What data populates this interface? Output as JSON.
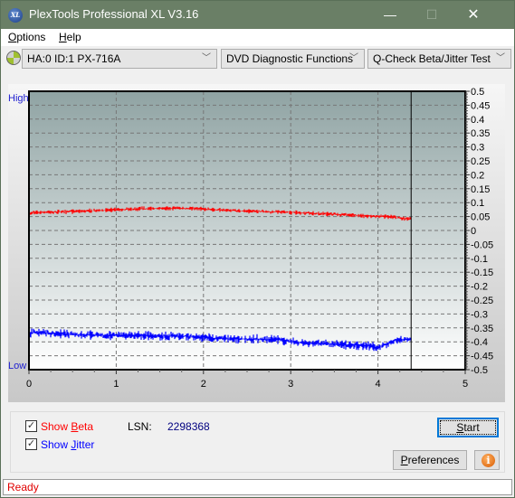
{
  "window": {
    "title": "PlexTools Professional XL V3.16",
    "app_icon_text": "XL",
    "controls": {
      "minimize": "—",
      "maximize": "☐",
      "close": "✕"
    }
  },
  "menu": {
    "items": [
      {
        "label": "Options",
        "accel": "O",
        "rest": "ptions"
      },
      {
        "label": "Help",
        "accel": "H",
        "rest": "elp"
      }
    ]
  },
  "toolbar": {
    "drive_select": "HA:0 ID:1  PX-716A",
    "function_select": "DVD Diagnostic Functions",
    "test_select": "Q-Check Beta/Jitter Test",
    "chevron": "﹀"
  },
  "chart_data": {
    "type": "line",
    "title": "",
    "xlabel": "",
    "ylabel": "",
    "y_left_labels": {
      "top": "High",
      "bottom": "Low"
    },
    "xlim": [
      0,
      5
    ],
    "ylim": [
      -0.5,
      0.5
    ],
    "x_ticks": [
      "0",
      "1",
      "2",
      "3",
      "4",
      "5"
    ],
    "y_ticks": [
      "0.5",
      "0.45",
      "0.4",
      "0.35",
      "0.3",
      "0.25",
      "0.2",
      "0.15",
      "0.1",
      "0.05",
      "0",
      "-0.05",
      "-0.1",
      "-0.15",
      "-0.2",
      "-0.25",
      "-0.3",
      "-0.35",
      "-0.4",
      "-0.45",
      "-0.5"
    ],
    "grid": true,
    "marker_x": 4.38,
    "series": [
      {
        "name": "Beta",
        "color": "#ff0000",
        "x": [
          0,
          0.05,
          0.2,
          0.5,
          0.8,
          1.0,
          1.2,
          1.5,
          1.7,
          2.0,
          2.2,
          2.5,
          3.0,
          3.5,
          3.9,
          4.1,
          4.3,
          4.38
        ],
        "y": [
          0.058,
          0.065,
          0.066,
          0.068,
          0.072,
          0.075,
          0.077,
          0.079,
          0.08,
          0.077,
          0.073,
          0.07,
          0.065,
          0.058,
          0.052,
          0.05,
          0.043,
          0.042
        ],
        "noise": 0.006
      },
      {
        "name": "Jitter",
        "color": "#0000ff",
        "x": [
          0,
          0.1,
          0.3,
          0.6,
          1.0,
          1.5,
          1.9,
          2.1,
          2.5,
          2.9,
          3.0,
          3.3,
          3.6,
          3.9,
          4.0,
          4.1,
          4.2,
          4.38
        ],
        "y": [
          -0.37,
          -0.365,
          -0.37,
          -0.375,
          -0.377,
          -0.378,
          -0.382,
          -0.388,
          -0.39,
          -0.392,
          -0.4,
          -0.405,
          -0.41,
          -0.415,
          -0.42,
          -0.41,
          -0.395,
          -0.39
        ],
        "noise": 0.012
      }
    ]
  },
  "controls": {
    "show_beta": {
      "label_pre": "Show ",
      "accel": "B",
      "rest": "eta",
      "checked": true,
      "color": "#ff0000"
    },
    "show_jitter": {
      "label_pre": "Show ",
      "accel": "J",
      "rest": "itter",
      "checked": true,
      "color": "#0000ff"
    },
    "lsn_label": "LSN:",
    "lsn_value": "2298368",
    "start_button": {
      "accel": "S",
      "rest": "tart"
    },
    "preferences_button": {
      "accel": "P",
      "rest": "references"
    },
    "info_icon": "i"
  },
  "status": {
    "text": "Ready"
  }
}
